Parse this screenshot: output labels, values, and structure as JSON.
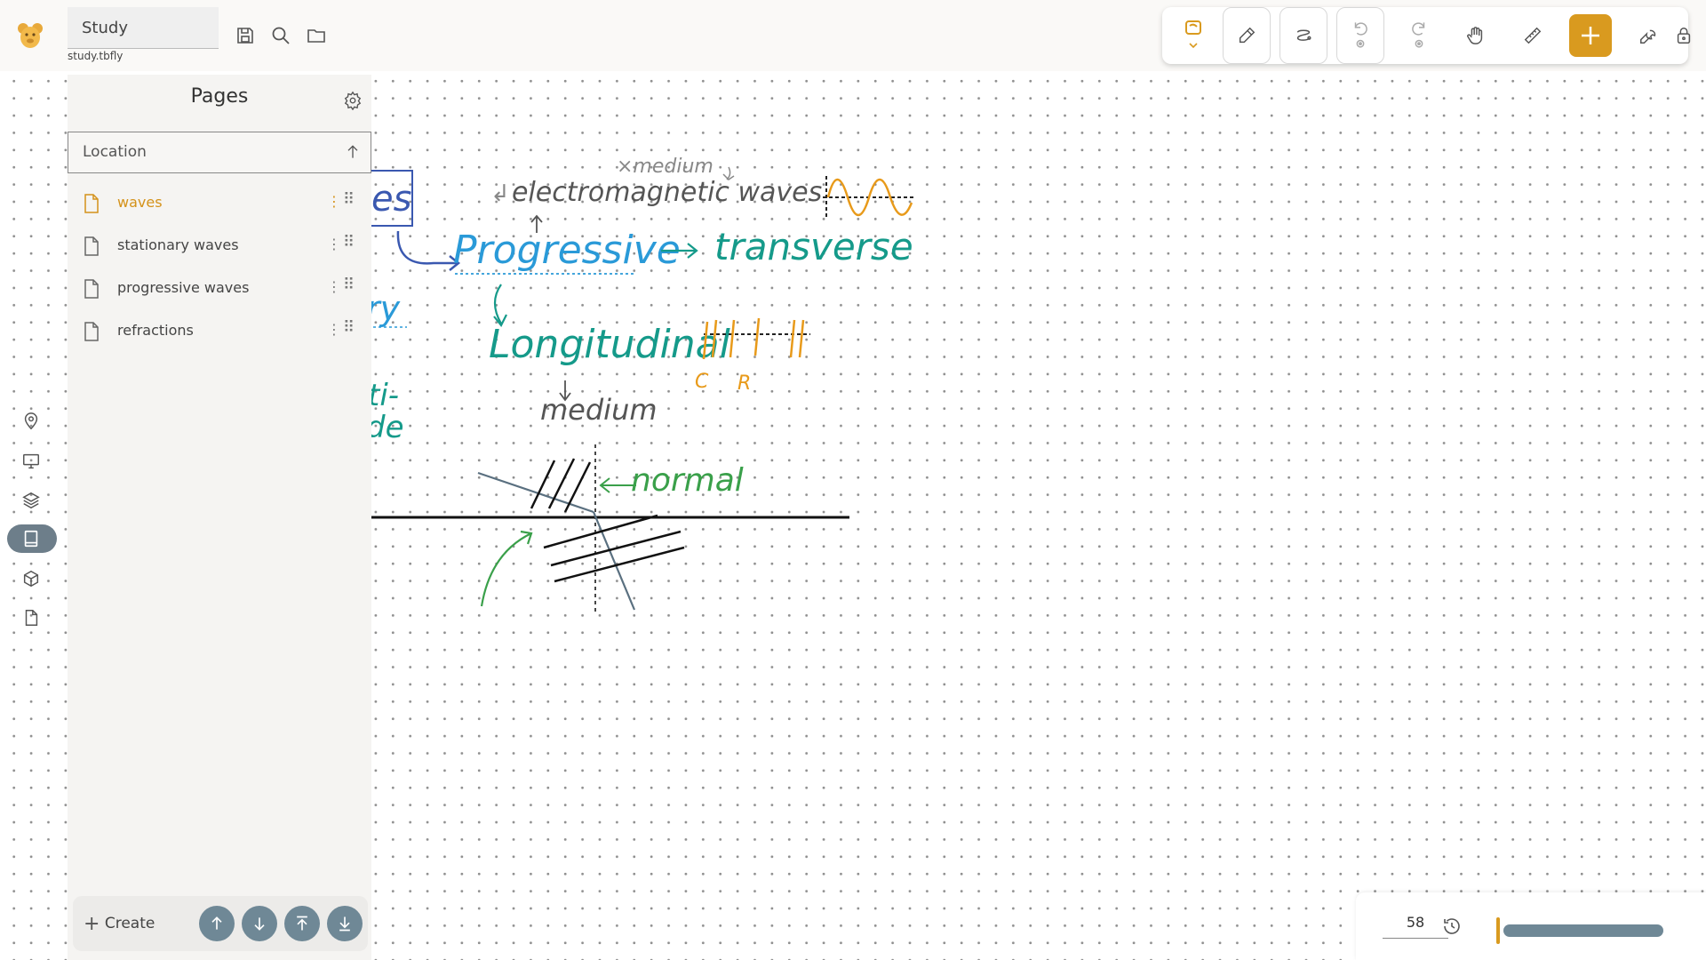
{
  "app": {
    "doc_title": "Study",
    "file_name": "study.tbfly"
  },
  "toolbar": {
    "tools": [
      "pen-icon",
      "eraser-icon",
      "lasso-icon",
      "undo-icon",
      "redo-icon",
      "hand-icon",
      "ruler-icon",
      "add-icon",
      "wrench-icon",
      "lock-icon"
    ]
  },
  "panel": {
    "title": "Pages",
    "sort_label": "Location",
    "pages": [
      {
        "label": "waves",
        "active": true
      },
      {
        "label": "stationary waves",
        "active": false
      },
      {
        "label": "progressive waves",
        "active": false
      },
      {
        "label": "refractions",
        "active": false
      }
    ],
    "create_label": "Create"
  },
  "zoom": {
    "value": "58"
  },
  "colors": {
    "accent": "#d99a1f",
    "nav_button": "#6f8896"
  },
  "canvas": {
    "notes": {
      "es": "es",
      "ry": "ry",
      "ti": "ti-",
      "de": "de",
      "medium_top": "×medium",
      "electromagnetic": "electromagnetic waves",
      "progressive": "Progressive",
      "transverse": "transverse",
      "longitudinal": "Longitudinal",
      "medium": "medium",
      "normal": "normal",
      "c": "C",
      "r": "R"
    }
  }
}
